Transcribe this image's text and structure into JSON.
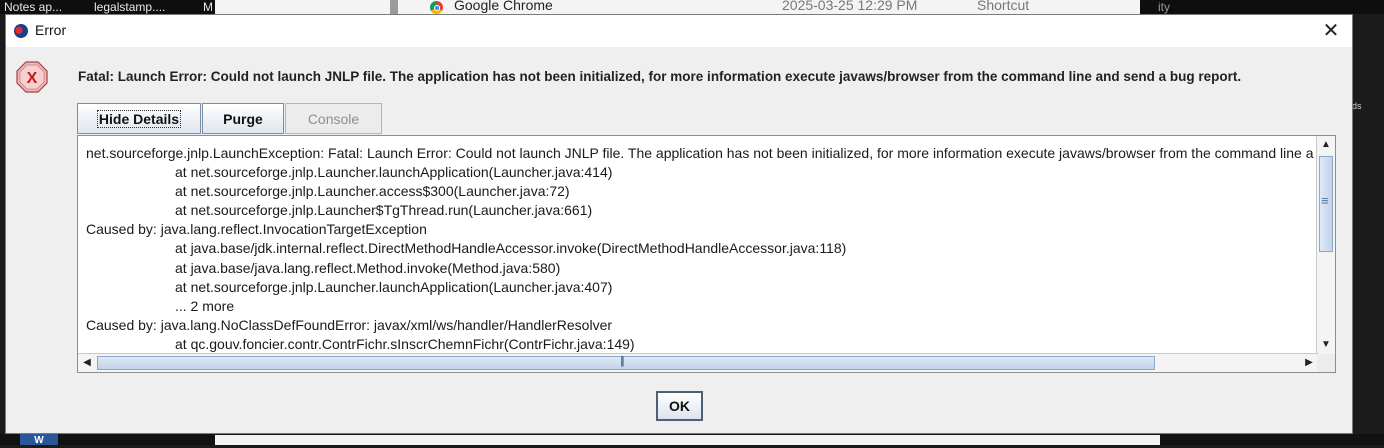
{
  "background": {
    "top_tabs": [
      "Notes ap...",
      "legalstamp....",
      "M"
    ],
    "explorer_row": {
      "name": "Google Chrome",
      "date": "2025-03-25 12:29 PM",
      "type": "Shortcut"
    },
    "right_fragment": "ity",
    "side_fragment": "ds",
    "taskbar_app": "W"
  },
  "dialog": {
    "title": "Error",
    "close_glyph": "✕",
    "error_icon_letter": "X",
    "message": "Fatal: Launch Error: Could not launch JNLP file. The application has not been initialized, for more information execute javaws/browser from the command line and send a bug report.",
    "buttons": {
      "hide_details": "Hide Details",
      "purge": "Purge",
      "console": "Console",
      "ok": "OK"
    },
    "trace_lines": [
      {
        "text": "net.sourceforge.jnlp.LaunchException: Fatal: Launch Error: Could not launch JNLP file. The application has not been initialized, for more information execute javaws/browser from the command line and send a bug report.",
        "indent": false
      },
      {
        "text": "at net.sourceforge.jnlp.Launcher.launchApplication(Launcher.java:414)",
        "indent": true
      },
      {
        "text": "at net.sourceforge.jnlp.Launcher.access$300(Launcher.java:72)",
        "indent": true
      },
      {
        "text": "at net.sourceforge.jnlp.Launcher$TgThread.run(Launcher.java:661)",
        "indent": true
      },
      {
        "text": "Caused by: java.lang.reflect.InvocationTargetException",
        "indent": false
      },
      {
        "text": "at java.base/jdk.internal.reflect.DirectMethodHandleAccessor.invoke(DirectMethodHandleAccessor.java:118)",
        "indent": true
      },
      {
        "text": "at java.base/java.lang.reflect.Method.invoke(Method.java:580)",
        "indent": true
      },
      {
        "text": "at net.sourceforge.jnlp.Launcher.launchApplication(Launcher.java:407)",
        "indent": true
      },
      {
        "text": "... 2 more",
        "indent": true
      },
      {
        "text": "Caused by: java.lang.NoClassDefFoundError: javax/xml/ws/handler/HandlerResolver",
        "indent": false
      },
      {
        "text": "at qc.gouv.foncier.contr.ContrFichr.sInscrChemnFichr(ContrFichr.java:149)",
        "indent": true
      }
    ]
  }
}
